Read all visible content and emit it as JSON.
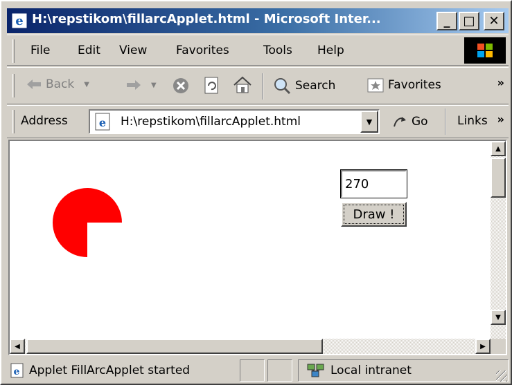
{
  "window": {
    "title": "H:\\repstikom\\fillarcApplet.html - Microsoft Inter...",
    "minimize": "_",
    "maximize": "□",
    "close": "✕"
  },
  "menu": {
    "items": [
      "File",
      "Edit",
      "View",
      "Favorites",
      "Tools",
      "Help"
    ]
  },
  "toolbar": {
    "back_label": "Back",
    "search_label": "Search",
    "favorites_label": "Favorites",
    "more": "»"
  },
  "address": {
    "label": "Address",
    "url": "H:\\repstikom\\fillarcApplet.html",
    "go_label": "Go",
    "links_label": "Links",
    "more": "»"
  },
  "applet": {
    "arc_color": "#ff0000",
    "arc_extent_degrees": 270,
    "input_value": "270",
    "draw_label": "Draw !"
  },
  "status": {
    "message": "Applet FillArcApplet started",
    "zone": "Local intranet"
  }
}
